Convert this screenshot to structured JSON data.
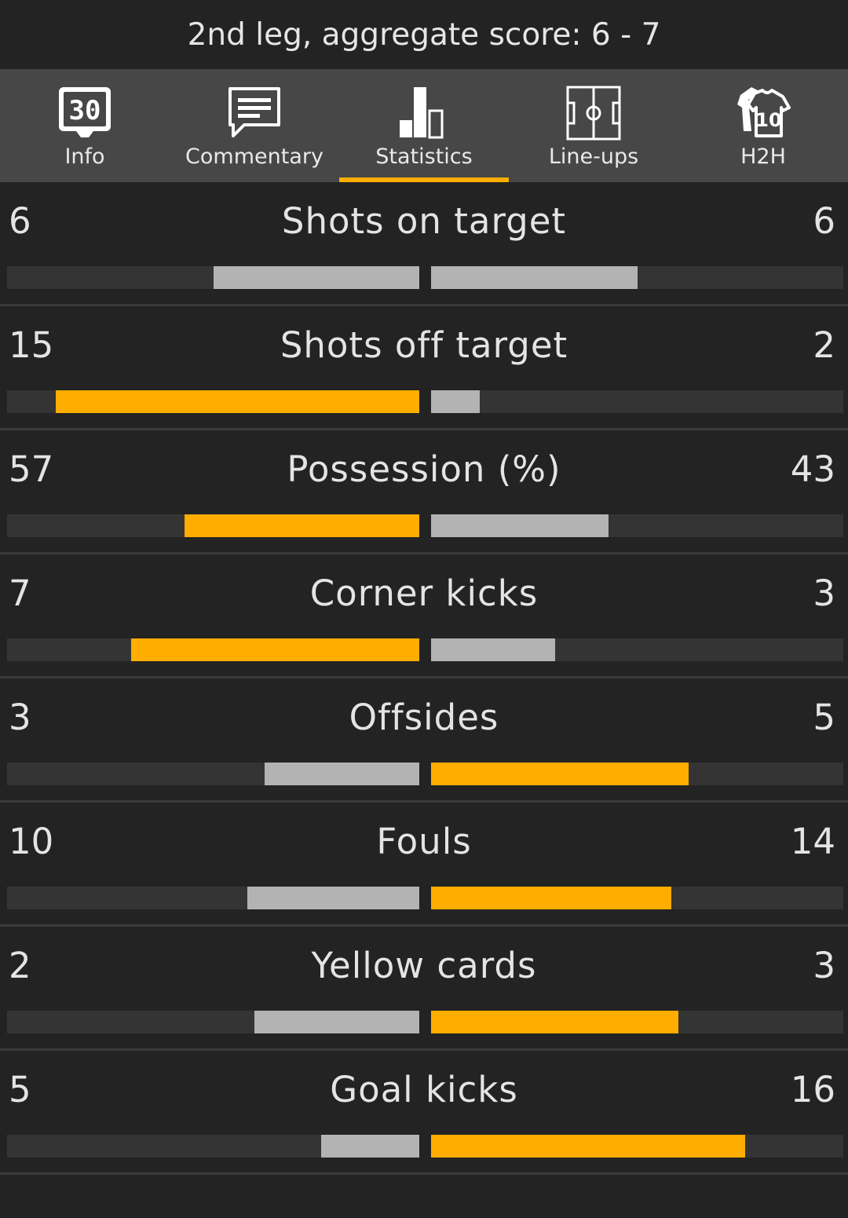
{
  "header": {
    "title": "2nd leg, aggregate score: 6 - 7"
  },
  "tabs": [
    {
      "key": "info",
      "label": "Info",
      "icon": "scoreboard-icon",
      "icon_text": "30",
      "active": false
    },
    {
      "key": "commentary",
      "label": "Commentary",
      "icon": "speech-bubble-icon",
      "active": false
    },
    {
      "key": "statistics",
      "label": "Statistics",
      "icon": "bar-chart-icon",
      "active": true
    },
    {
      "key": "lineups",
      "label": "Line-ups",
      "icon": "pitch-icon",
      "active": false
    },
    {
      "key": "h2h",
      "label": "H2H",
      "icon": "jersey-icon",
      "icon_text": "10",
      "active": false
    }
  ],
  "colors": {
    "accent": "#ffad00",
    "neutral_bar": "#b3b3b3",
    "track": "#343434",
    "tabbar_bg": "#474747",
    "page_bg": "#232323"
  },
  "stats": [
    {
      "label": "Shots on target",
      "home": 6,
      "away": 6
    },
    {
      "label": "Shots off target",
      "home": 15,
      "away": 2
    },
    {
      "label": "Possession (%)",
      "home": 57,
      "away": 43
    },
    {
      "label": "Corner kicks",
      "home": 7,
      "away": 3
    },
    {
      "label": "Offsides",
      "home": 3,
      "away": 5
    },
    {
      "label": "Fouls",
      "home": 10,
      "away": 14
    },
    {
      "label": "Yellow cards",
      "home": 2,
      "away": 3
    },
    {
      "label": "Goal kicks",
      "home": 5,
      "away": 16
    }
  ]
}
